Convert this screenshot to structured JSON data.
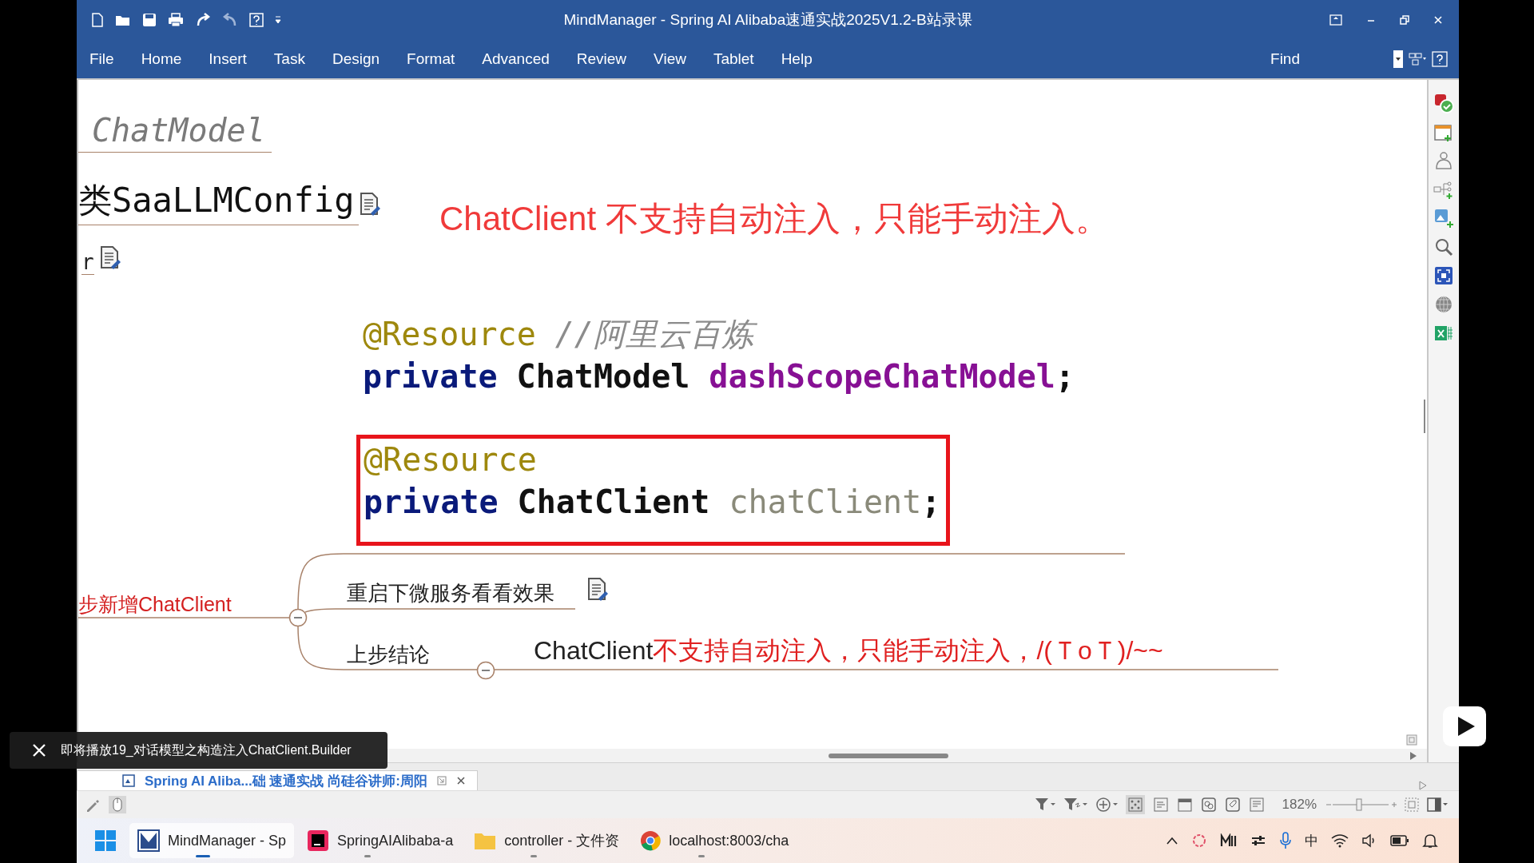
{
  "window": {
    "title": "MindManager - Spring AI Alibaba速通实战2025V1.2-B站录课"
  },
  "menu": [
    "File",
    "Home",
    "Insert",
    "Task",
    "Design",
    "Format",
    "Advanced",
    "Review",
    "View",
    "Tablet",
    "Help"
  ],
  "find_label": "Find",
  "map": {
    "chatmodel_topic": "ChatModel",
    "config_topic": "类SaaLLMConfig",
    "r_topic": "r",
    "callout": "ChatClient 不支持自动注入，只能手动注入。",
    "code_blocks": [
      {
        "highlighted": false,
        "lines": [
          [
            {
              "kind": "annotation",
              "text": "@Resource"
            },
            {
              "kind": "comment",
              "text": "//阿里云百炼"
            }
          ],
          [
            {
              "kind": "keyword",
              "text": "private"
            },
            {
              "kind": "type",
              "text": "ChatModel"
            },
            {
              "kind": "field",
              "text": "dashScopeChatModel"
            },
            {
              "kind": "punct",
              "text": ";"
            }
          ]
        ]
      },
      {
        "highlighted": true,
        "lines": [
          [
            {
              "kind": "annotation",
              "text": "@Resource"
            }
          ],
          [
            {
              "kind": "keyword",
              "text": "private"
            },
            {
              "kind": "type",
              "text": "ChatClient"
            },
            {
              "kind": "unused",
              "text": "chatClient"
            },
            {
              "kind": "punct",
              "text": ";"
            }
          ]
        ]
      }
    ],
    "branch_topic": "步新增ChatClient",
    "subtopics": [
      "重启下微服务看看效果",
      "上步结论"
    ],
    "conclusion": {
      "prefix": "ChatClient",
      "highlight": "不支持自动注入，只能手动注入，/(ＴoＴ)/~~"
    }
  },
  "document_tab": "Spring AI Aliba...础 速通实战 尚硅谷讲师:周阳",
  "zoom": "182%",
  "taskbar": [
    {
      "label": "MindManager - Sp",
      "kind": "mindmanager",
      "selected": true
    },
    {
      "label": "SpringAIAlibaba-a",
      "kind": "ide",
      "selected": false
    },
    {
      "label": "controller - 文件资",
      "kind": "folder",
      "selected": false
    },
    {
      "label": "localhost:8003/cha",
      "kind": "browser",
      "selected": false
    }
  ],
  "ime": "中",
  "toast": "即将播放19_对话模型之构造注入ChatClient.Builder"
}
